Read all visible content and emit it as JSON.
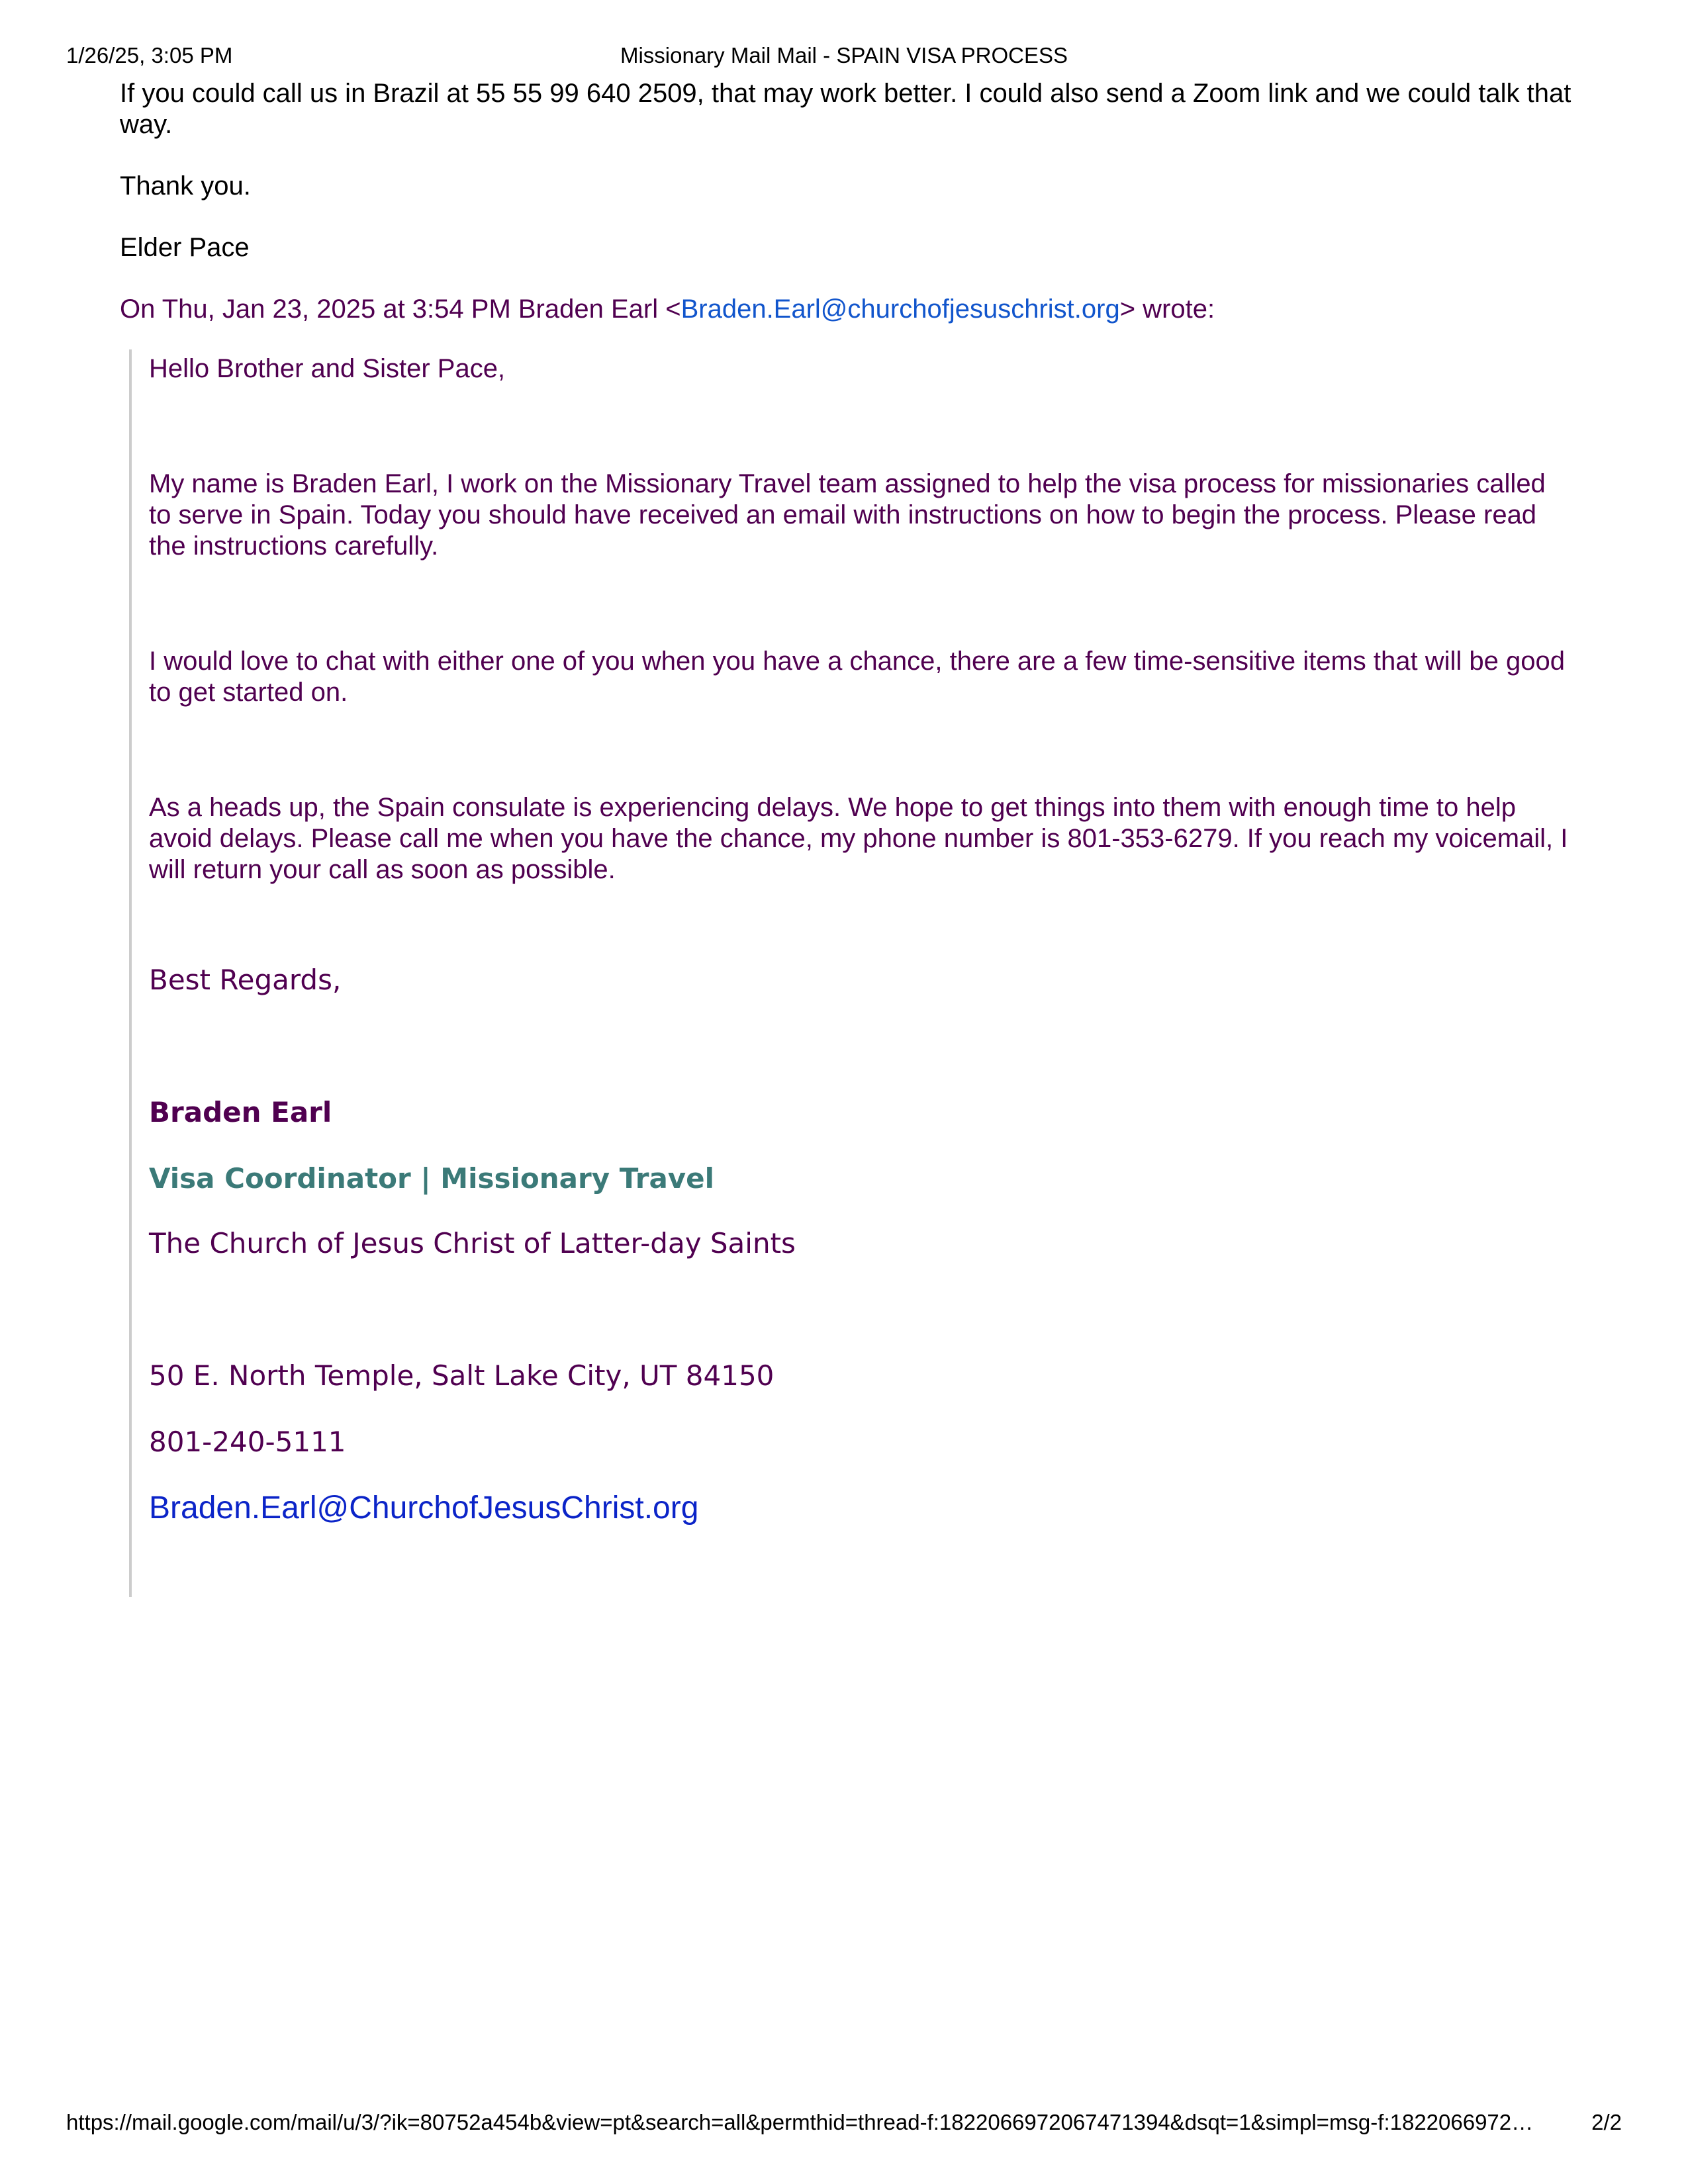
{
  "print_header": {
    "date": "1/26/25, 3:05 PM",
    "title": "Missionary Mail Mail - SPAIN VISA PROCESS"
  },
  "reply": {
    "paragraph1": "If you could call us in Brazil at 55 55 99 640 2509, that may work better. I could also send a Zoom link and we could talk that way.",
    "thanks": "Thank you.",
    "signature": "Elder Pace"
  },
  "quote_header": {
    "prefix": "On Thu, Jan 23, 2025 at 3:54 PM Braden Earl <",
    "email": "Braden.Earl@churchofjesuschrist.org",
    "suffix": "> wrote:"
  },
  "quoted": {
    "greeting": "Hello Brother and Sister Pace,",
    "paragraph1": "My name is Braden Earl, I work on the Missionary Travel team assigned to help the visa process for missionaries called to serve in Spain. Today you should have received an email with instructions on how to begin the process. Please read the instructions carefully.",
    "paragraph2": "I would love to chat with either one of you when you have a chance, there are a few time-sensitive items that will be good to get started on.",
    "paragraph3": "As a heads up, the Spain consulate is experiencing delays. We hope to get things into them with enough time to help avoid delays. Please call me when you have the chance, my phone number is 801-353-6279. If you reach my voicemail, I will return your call as soon as possible.",
    "signature": {
      "regards": "Best Regards,",
      "name": "Braden Earl",
      "role": "Visa Coordinator | Missionary Travel",
      "organization": "The Church of Jesus Christ of Latter-day Saints",
      "address": "50 E. North Temple, Salt Lake City, UT 84150",
      "phone": "801-240-5111",
      "email": "Braden.Earl@ChurchofJesusChrist.org"
    }
  },
  "print_footer": {
    "url": "https://mail.google.com/mail/u/3/?ik=80752a454b&view=pt&search=all&permthid=thread-f:1822066972067471394&dsqt=1&simpl=msg-f:1822066972…",
    "page": "2/2"
  },
  "colors": {
    "quote_text": "#500050",
    "link": "#1155cc",
    "role_teal": "#3b7a78",
    "signature_email": "#0b24c8"
  }
}
